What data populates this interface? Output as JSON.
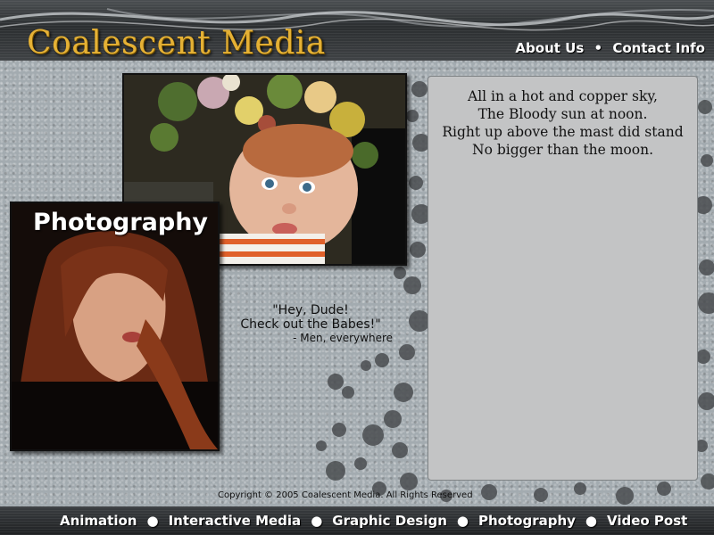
{
  "header": {
    "logo": "Coalescent Media",
    "nav": [
      {
        "label": "About Us"
      },
      {
        "label": "Contact Info"
      }
    ],
    "separator": "•"
  },
  "photos": {
    "baby_alt": "Photo of a baby with a flower crown",
    "girl_alt": "Photo of a woman with red hair",
    "section_title": "Photography"
  },
  "quote": {
    "line1": "\"Hey, Dude!",
    "line2": "Check out the Babes!\"",
    "attribution": "- Men, everywhere"
  },
  "poem": {
    "lines": [
      "All in a hot and copper sky,",
      "The Bloody sun at noon.",
      "Right up above the mast did stand",
      "No bigger than the moon."
    ]
  },
  "copyright": "Copyright © 2005 Coalescent Media. All Rights Reserved",
  "footer": {
    "bullet": "●",
    "nav": [
      {
        "label": "Animation"
      },
      {
        "label": "Interactive Media"
      },
      {
        "label": "Graphic Design"
      },
      {
        "label": "Photography"
      },
      {
        "label": "Video Post"
      }
    ]
  },
  "colors": {
    "logo": "#e5b135",
    "background": "#a3abb0",
    "panel": "#c3c4c5"
  }
}
